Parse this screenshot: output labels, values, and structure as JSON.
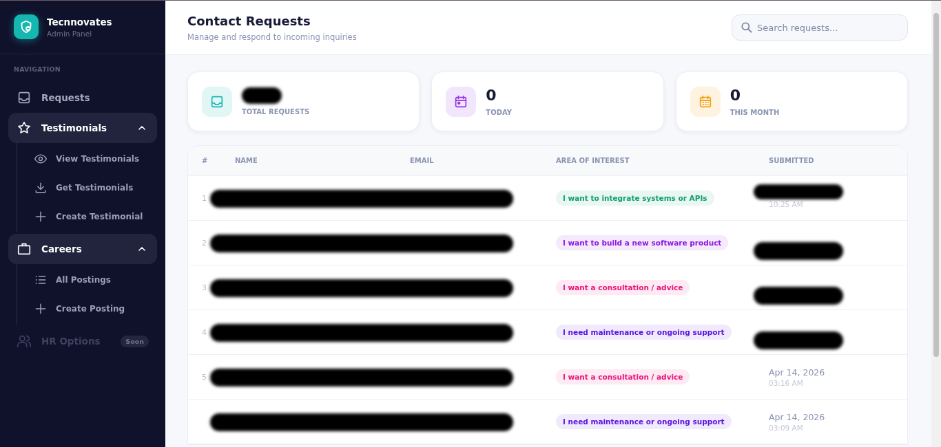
{
  "brand": {
    "name": "Tecnnovates",
    "subtitle": "Admin Panel"
  },
  "sidebar": {
    "section_label": "NAVIGATION",
    "items": [
      {
        "kind": "link",
        "label": "Requests",
        "selected": false
      },
      {
        "kind": "group",
        "label": "Testimonials",
        "expanded": true,
        "children": [
          {
            "label": "View Testimonials"
          },
          {
            "label": "Get Testimonials"
          },
          {
            "label": "Create Testimonial"
          }
        ]
      },
      {
        "kind": "group",
        "label": "Careers",
        "expanded": true,
        "children": [
          {
            "label": "All Postings"
          },
          {
            "label": "Create Posting"
          }
        ]
      },
      {
        "kind": "link",
        "label": "HR Options",
        "disabled": true,
        "badge": "Soon"
      }
    ]
  },
  "header": {
    "title": "Contact Requests",
    "subtitle": "Manage and respond to incoming inquiries",
    "search": {
      "placeholder": "Search requests..."
    }
  },
  "stats": [
    {
      "color": "#14b8b0",
      "value_redacted": true,
      "label": "TOTAL REQUESTS"
    },
    {
      "color": "#9333ea",
      "value": "0",
      "label": "TODAY"
    },
    {
      "color": "#f59e0b",
      "value": "0",
      "label": "THIS MONTH"
    }
  ],
  "table": {
    "columns": [
      "#",
      "NAME",
      "EMAIL",
      "AREA OF INTEREST",
      "SUBMITTED"
    ],
    "rows": [
      {
        "number": "1",
        "contact_redacted": true,
        "interest": {
          "text": "I want to integrate systems or APIs",
          "color": "#0f9f6e"
        },
        "submitted": {
          "time": "10:25 AM",
          "redacted": true
        }
      },
      {
        "number": "2",
        "contact_redacted": true,
        "interest": {
          "text": "I want to build a new software product",
          "color": "#8b1ae0"
        },
        "submitted": {
          "redacted": true
        }
      },
      {
        "number": "3",
        "contact_redacted": true,
        "interest": {
          "text": "I want a consultation / advice",
          "color": "#e8157a"
        },
        "submitted": {
          "redacted": true
        }
      },
      {
        "number": "4",
        "contact_redacted": true,
        "interest": {
          "text": "I need maintenance or ongoing support",
          "color": "#5b16e0"
        },
        "submitted": {
          "redacted": true
        }
      },
      {
        "number": "5",
        "contact_redacted": true,
        "interest": {
          "text": "I want a consultation / advice",
          "color": "#e8157a"
        },
        "submitted": {
          "date": "Apr 14, 2026",
          "time": "03:16 AM",
          "redacted": false
        }
      },
      {
        "contact_redacted": true,
        "interest": {
          "text": "I need maintenance or ongoing support",
          "color": "#5b16e0"
        },
        "submitted": {
          "date": "Apr 14, 2026",
          "time": "03:09 AM",
          "redacted": false
        }
      }
    ]
  }
}
